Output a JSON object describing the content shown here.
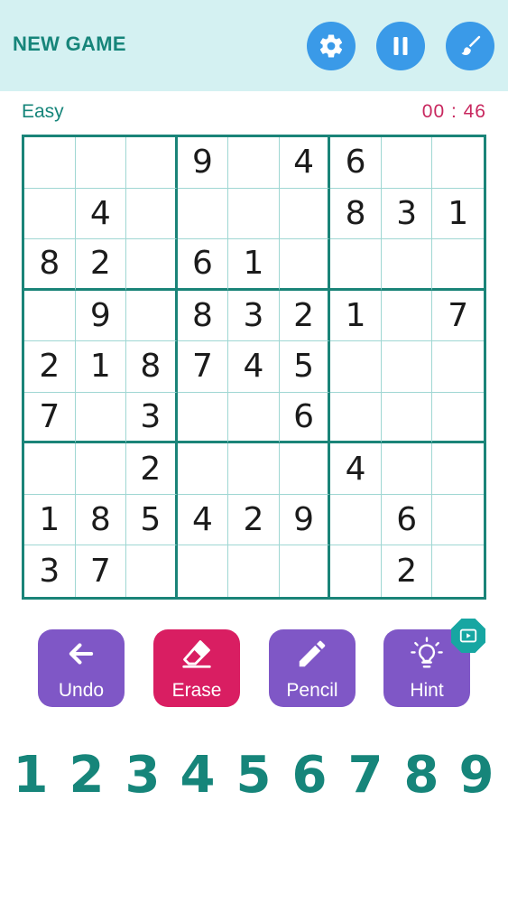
{
  "header": {
    "new_game_label": "NEW GAME",
    "settings_icon": "gear-icon",
    "pause_icon": "pause-icon",
    "theme_icon": "paint-brush-icon"
  },
  "status": {
    "difficulty": "Easy",
    "timer": "00 : 46"
  },
  "board": {
    "rows": [
      [
        "",
        "",
        "",
        "9",
        "",
        "4",
        "6",
        "",
        ""
      ],
      [
        "",
        "4",
        "",
        "",
        "",
        "",
        "8",
        "3",
        "1"
      ],
      [
        "8",
        "2",
        "",
        "6",
        "1",
        "",
        "",
        "",
        ""
      ],
      [
        "",
        "9",
        "",
        "8",
        "3",
        "2",
        "1",
        "",
        "7"
      ],
      [
        "2",
        "1",
        "8",
        "7",
        "4",
        "5",
        "",
        "",
        ""
      ],
      [
        "7",
        "",
        "3",
        "",
        "",
        "6",
        "",
        "",
        ""
      ],
      [
        "",
        "",
        "2",
        "",
        "",
        "",
        "4",
        "",
        ""
      ],
      [
        "1",
        "8",
        "5",
        "4",
        "2",
        "9",
        "",
        "6",
        ""
      ],
      [
        "3",
        "7",
        "",
        "",
        "",
        "",
        "",
        "2",
        ""
      ]
    ]
  },
  "tools": [
    {
      "label": "Undo",
      "icon": "arrow-left-icon"
    },
    {
      "label": "Erase",
      "icon": "eraser-icon"
    },
    {
      "label": "Pencil",
      "icon": "pencil-icon"
    },
    {
      "label": "Hint",
      "icon": "lightbulb-icon"
    }
  ],
  "numpad": [
    "1",
    "2",
    "3",
    "4",
    "5",
    "6",
    "7",
    "8",
    "9"
  ],
  "colors": {
    "accent": "#16857a",
    "header_bg": "#d4f1f2",
    "button_blue": "#3a9ae8",
    "tool_purple": "#7f57c6",
    "tool_pink": "#d91e62",
    "timer": "#c8275e"
  }
}
